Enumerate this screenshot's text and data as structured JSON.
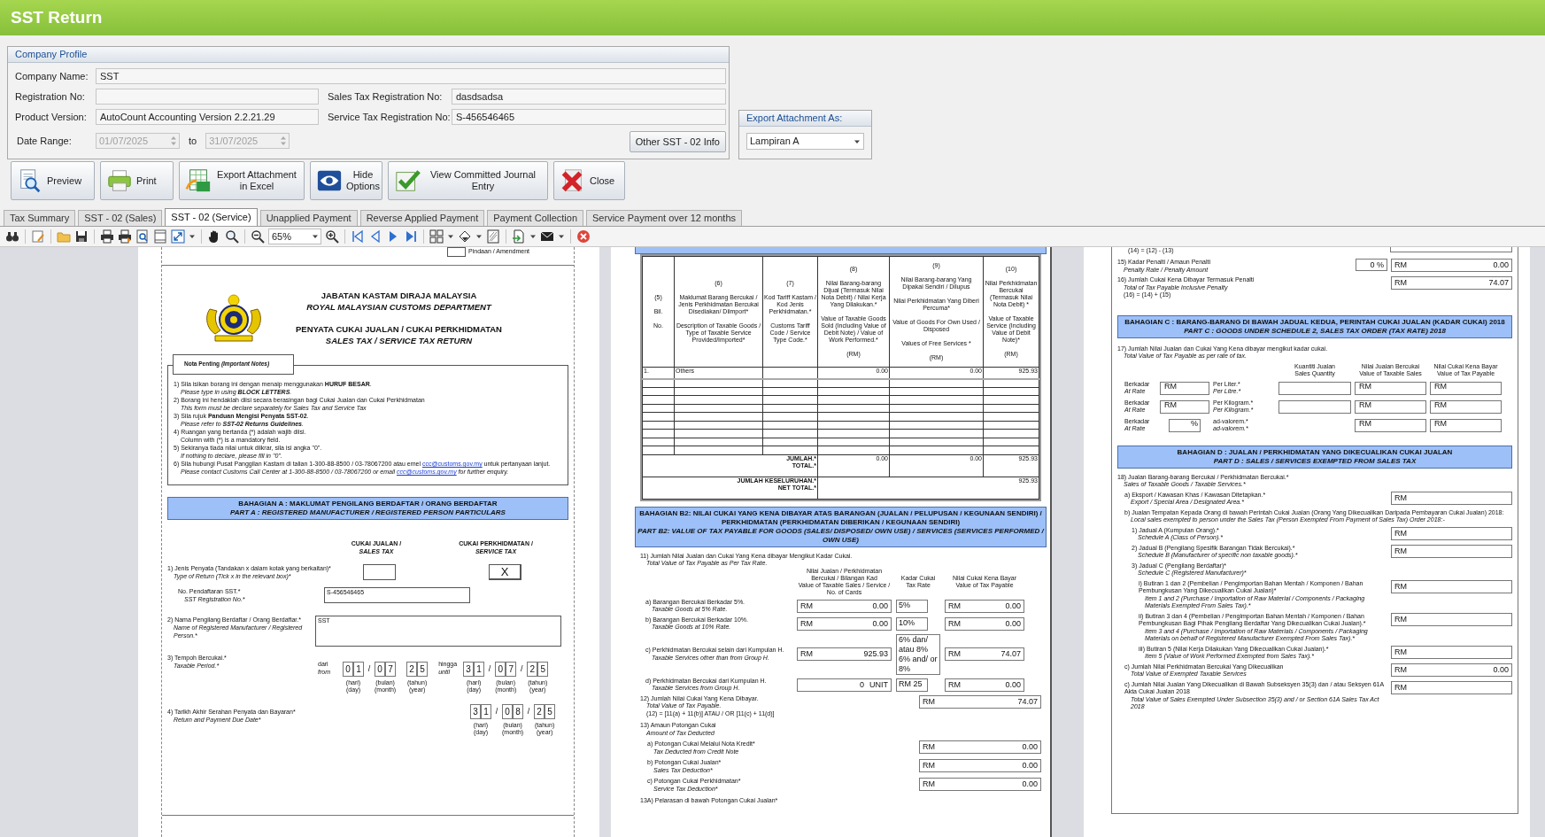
{
  "window": {
    "title": "SST Return"
  },
  "company_profile": {
    "title": "Company Profile",
    "company_name": {
      "label": "Company Name:",
      "value": "SST"
    },
    "registration_no": {
      "label": "Registration No:"
    },
    "sales_tax_registration_no": {
      "label": "Sales Tax Registration No:",
      "value": "dasdsadsa"
    },
    "product_version": {
      "label": "Product Version:",
      "value": "AutoCount Accounting Version 2.2.21.29"
    },
    "service_tax_registration_no": {
      "label": "Service Tax Registration No:",
      "value": "S-456546465"
    },
    "date_range": {
      "label": "Date Range:",
      "from": "01/07/2025",
      "to_label": "to",
      "to": "31/07/2025",
      "disabled": true
    },
    "other_info_button": "Other SST - 02 Info"
  },
  "export_attachment": {
    "title": "Export Attachment As:",
    "value": "Lampiran A"
  },
  "buttons": [
    {
      "kind": "preview",
      "label": "Preview"
    },
    {
      "kind": "print",
      "label": "Print"
    },
    {
      "kind": "excel",
      "label": "Export Attachment in Excel"
    },
    {
      "kind": "hide",
      "label": "Hide Options"
    },
    {
      "kind": "journal",
      "label": "View Committed Journal Entry"
    },
    {
      "kind": "close",
      "label": "Close"
    }
  ],
  "tabs": [
    {
      "label": "Tax Summary",
      "selected": false
    },
    {
      "label": "SST - 02 (Sales)",
      "selected": false
    },
    {
      "label": "SST - 02 (Service)",
      "selected": true
    },
    {
      "label": "Unapplied Payment",
      "selected": false
    },
    {
      "label": "Reverse Applied Payment",
      "selected": false
    },
    {
      "label": "Payment Collection",
      "selected": false
    },
    {
      "label": "Service Payment over 12 months",
      "selected": false
    }
  ],
  "toolbar": {
    "zoom": "65%"
  },
  "pages": [
    {
      "amendment": {
        "label": "Pindaan / Amendment",
        "checked": false
      },
      "header": {
        "agency": "JABATAN KASTAM DIRAJA MALAYSIA",
        "agency_english": "ROYAL MALAYSIAN CUSTOMS DEPARTMENT",
        "form": "PENYATA CUKAI JUALAN / CUKAI PERKHIDMATAN",
        "form_english": "SALES TAX / SERVICE TAX RETURN"
      },
      "notes": {
        "title": "Nota Penting *(Important Notes)*",
        "items": [
          {
            "malay": "1) Sila isikan borang ini dengan menaip menggunakan **HURUF BESAR**.",
            "english": "Please type in using **BLOCK LETTERS**."
          },
          {
            "malay": "2) Borang ini hendaklah diisi secara berasingan bagi Cukai Jualan dan Cukai Perkhidmatan",
            "english": "This form must be declare separately for Sales Tax and Service Tax"
          },
          {
            "malay": "3) Sila rujuk **Panduan Mengisi Penyata SST-02**.",
            "english": "Please refer to **SST-02 Returns Guidelines**."
          },
          {
            "malay": "4) Ruangan yang bertanda (*) adalah wajib diisi.",
            "english_plain": "Column with (*) is a mandatory field."
          },
          {
            "malay": "5) Sekiranya tiada nilai untuk diikrar, sila isi angka \"0\".",
            "english": "If nothing to declare, please fill in \"0\"."
          },
          {
            "malay": "6) Sila hubungi Pusat Panggilan Kastam di talian 1-300-88-8500 / 03-78067200 atau emel",
            "malay_link": "ccc@customs.gov.my",
            "malay_after": "untuk pertanyaan lanjut.",
            "english": "Please contact Customs Call Center at 1-300-88-8500 / 03-78067200 or email",
            "english_link": "ccc@customs.gov.my",
            "english_after": "for further enquiry."
          }
        ]
      },
      "band": {
        "malay": "BAHAGIAN A : MAKLUMAT PENGILANG BERDAFTAR / ORANG BERDAFTAR",
        "english": "PART A : REGISTERED MANUFACTURER / REGISTERED PERSON PARTICULARS"
      },
      "columns": [
        {
          "malay": "CUKAI JUALAN /",
          "english": "SALES TAX"
        },
        {
          "malay": "CUKAI PERKHIDMATAN /",
          "english": "SERVICE TAX"
        }
      ],
      "return_type": {
        "label": "1) Jenis Penyata (Tandakan x dalam kotak yang berkaitan)*",
        "english": "Type of Return (Tick x in the relevant box)*",
        "boxes": [
          {
            "checked": false
          },
          {
            "checked": true,
            "mark": "X"
          }
        ]
      },
      "registration": {
        "label": "No. Pendaftaran SST.*",
        "english": "SST Registration No.*",
        "value": "S-456546465"
      },
      "name": {
        "label": "2) Nama Pengilang Berdaftar / Orang Berdaftar.*",
        "english": "Name of Registered Manufacturer / Registered Person.*",
        "value": "SST"
      },
      "period": {
        "label": "3) Tempoh Bercukai.*",
        "english": "Taxable Period.*",
        "from": {
          "malay": "dari",
          "english": "from",
          "parts": [
            {
              "digits": [
                "0",
                "1"
              ],
              "malay": "(hari)",
              "english": "(day)"
            },
            {
              "digits": [
                "0",
                "7"
              ],
              "malay": "(bulan)",
              "english": "(month)"
            },
            {
              "digits": [
                "2",
                "5"
              ],
              "malay": "(tahun)",
              "english": "(year)"
            }
          ],
          "separators": [
            "/"
          ]
        },
        "until": {
          "malay": "hingga",
          "english": "until",
          "parts": [
            {
              "digits": [
                "3",
                "1"
              ],
              "malay": "(hari)",
              "english": "(day)"
            },
            {
              "digits": [
                "0",
                "7"
              ],
              "malay": "(bulan)",
              "english": "(month)"
            },
            {
              "digits": [
                "2",
                "5"
              ],
              "malay": "(tahun)",
              "english": "(year)"
            }
          ],
          "separators": [
            "/",
            "/"
          ]
        }
      },
      "due": {
        "label": "4) Tarikh Akhir Serahan Penyata dan Bayaran*",
        "english": "Return and Payment Due Date*",
        "date": {
          "parts": [
            {
              "digits": [
                "3",
                "1"
              ],
              "malay": "(hari)",
              "english": "(day)"
            },
            {
              "digits": [
                "0",
                "8"
              ],
              "malay": "(bulan)",
              "english": "(month)"
            },
            {
              "digits": [
                "2",
                "5"
              ],
              "malay": "(tahun)",
              "english": "(year)"
            }
          ],
          "separators": [
            "/",
            "/"
          ]
        }
      }
    },
    {
      "table": {
        "columns": [
          {
            "lines": [
              "(5)",
              "Bil.",
              "No."
            ]
          },
          {
            "lines": [
              "(6)",
              "Maklumat Barang Bercukai / Jenis Perkhidmatan Bercukai Disediakan/ Diimport*",
              "Description of Taxable Goods / Type of Taxable Service Provided/Imported*"
            ]
          },
          {
            "lines": [
              "(7)",
              "Kod Tariff Kastam / Kod Jenis Perkhidmatan.*",
              "Customs Tariff Code / Service Type Code.*"
            ]
          },
          {
            "lines": [
              "(8)",
              "Nilai Barang-barang Dijual (Termasuk Nilai Nota Debit) / Nilai Kerja Yang Dilakukan.*",
              "Value of Taxable Goods Sold (Including Value of Debit Note) / Value of Work Performed.*",
              "(RM)"
            ]
          },
          {
            "lines": [
              "(9)",
              "Nilai Barang-barang Yang Dipakai Sendiri / Dilupus",
              "Nilai Perkhidmatan Yang Diberi Percuma*",
              "Value of Goods For Own Used / Disposed",
              "Values of Free Services *",
              "(RM)"
            ]
          },
          {
            "lines": [
              "(10)",
              "Nilai Perkhidmatan Bercukai (Termasuk Nilai Nota Debit) *",
              "Value of Taxable Service (Including Value of Debit Note)*",
              "(RM)"
            ]
          }
        ],
        "rows": [
          [
            "1.",
            "Others",
            "",
            "0.00",
            "0.00",
            "925.93"
          ]
        ],
        "total": {
          "labels": "JUMLAH.*\nTOTAL.*",
          "values": [
            "0.00",
            "0.00",
            "925.93"
          ]
        },
        "net_total": {
          "labels": "JUMLAH KESELURUHAN.*\nNET TOTAL.*",
          "value": "925.93"
        }
      },
      "band": {
        "malay": "BAHAGIAN B2: NILAI CUKAI YANG KENA DIBAYAR ATAS BARANGAN (JUALAN / PELUPUSAN / KEGUNAAN SENDIRI) / PERKHIDMATAN (PERKHIDMATAN DIBERIKAN / KEGUNAAN SENDIRI)",
        "english": "PART B2: VALUE OF TAX PAYABLE FOR GOODS (SALES/ DISPOSED/ OWN USE) / SERVICES (SERVICES PERFORMED / OWN USE)"
      },
      "rates": {
        "label": "11) Jumlah Nilai Jualan dan Cukai Yang Kena dibayar Mengikut Kadar Cukai.",
        "english": "Total Value of Tax Payable as Per Tax Rate.",
        "columns": [
          {
            "malay": "Nilai Jualan / Perkhidmatan Bercukai / Bilangan Kad",
            "english": "Value of Taxable Sales / Service / No. of Cards"
          },
          {
            "malay": "Kadar Cukai",
            "english": "Tax Rate"
          },
          {
            "malay": "Nilai Cukai Kena Bayar",
            "english": "Value of Tax Payable"
          }
        ],
        "rows": [
          {
            "label": "a) Barangan Bercukai Berkadar 5%.",
            "english": "Taxable Goods at 5% Rate.",
            "amount": {
              "prefix": "RM",
              "value": "0.00"
            },
            "rate": "5%",
            "tax": {
              "prefix": "RM",
              "value": "0.00"
            }
          },
          {
            "label": "b) Barangan Bercukai Berkadar 10%.",
            "english": "Taxable Goods at 10% Rate.",
            "amount": {
              "prefix": "RM",
              "value": "0.00"
            },
            "rate": "10%",
            "tax": {
              "prefix": "RM",
              "value": "0.00"
            }
          },
          {
            "label": "c) Perkhidmatan Bercukai selain dari Kumpulan H.",
            "english": "Taxable Services other than from Group H.",
            "amount": {
              "prefix": "RM",
              "value": "925.93"
            },
            "rate": "6% dan/ atau 8% 6% and/ or 8%",
            "tax": {
              "prefix": "RM",
              "value": "74.07"
            }
          },
          {
            "label": "d) Perkhidmatan Bercukai dari Kumpulan H.",
            "english": "Taxable Services from Group H.",
            "amount": {
              "value": "0",
              "suffix": "UNIT"
            },
            "rate": "RM 25",
            "tax": {
              "prefix": "RM",
              "value": "0.00"
            }
          }
        ]
      },
      "items": [
        {
          "label": "12) Jumlah Nilai Cukai Yang Kena Dibayar.",
          "english": "Total Value of Tax Payable.",
          "formula": "(12) = [11(a) + 11(b)] ATAU / OR [11(c) + 11(d)]",
          "amount": {
            "prefix": "RM",
            "value": "74.07"
          }
        },
        {
          "label": "13) Amaun Potongan Cukai",
          "english": "Amount of Tax Deducted",
          "children": [
            {
              "label": "a) Potongan Cukai Melalui Nota Kredit*",
              "english": "Tax Deducted from Credit Note",
              "amount": {
                "prefix": "RM",
                "value": "0.00"
              }
            },
            {
              "label": "b) Potongan Cukai Jualan*",
              "english": "Sales Tax Deduction*",
              "amount": {
                "prefix": "RM",
                "value": "0.00"
              }
            },
            {
              "label": "c) Potongan Cukai Perkhidmatan*",
              "english": "Service Tax Deduction*",
              "amount": {
                "prefix": "RM",
                "value": "0.00"
              }
            }
          ]
        },
        {
          "label": "13A) Pelarasan di bawah Potongan Cukai Jualan*"
        }
      ]
    },
    {
      "top_formula": "(14) = (12) - (13)",
      "items_before": [
        {
          "label": "15) Kadar Penalti / Amaun Penalti",
          "english": "Penalty Rate / Penalty Amount",
          "rate": "0 %",
          "amount": {
            "prefix": "RM",
            "value": "0.00"
          }
        },
        {
          "label": "16) Jumlah Cukai Kena Dibayar Termasuk Penalti",
          "english": "Total of Tax Payable Inclusive Penalty",
          "formula": "(16) = (14) + (15)",
          "amount": {
            "prefix": "RM",
            "value": "74.07"
          }
        }
      ],
      "band_c": {
        "malay": "BAHAGIAN C : BARANG-BARANG DI BAWAH JADUAL KEDUA, PERINTAH CUKAI JUALAN (KADAR CUKAI) 2018",
        "english": "PART C : GOODS UNDER SCHEDULE 2, SALES TAX ORDER (TAX RATE) 2018"
      },
      "schedule": {
        "label": "17) Jumlah Nilai Jualan dan Cukai Yang Kena dibayar mengikut kadar cukai.",
        "english": "Total Value of Tax Payable as per rate of tax.",
        "columns": [
          {
            "malay": "Kuantiti Jualan",
            "english": "Sales Quantity"
          },
          {
            "malay": "Nilai Jualan Bercukai",
            "english": "Value of Taxable Sales"
          },
          {
            "malay": "Nilai Cukai Kena Bayar",
            "english": "Value of Tax Payable"
          }
        ],
        "rows": [
          {
            "kind": "quantity",
            "malay": "Berkadar",
            "english": "At Rate",
            "rate": "RM",
            "unit": "Per Liter.*",
            "unit_english": "Per Litre.*",
            "value": "RM",
            "tax": "RM"
          },
          {
            "kind": "quantity",
            "malay": "Berkadar",
            "english": "At Rate",
            "rate": "RM",
            "unit": "Per Kilogram.*",
            "unit_english": "Per Kilogram.*",
            "value": "RM",
            "tax": "RM"
          },
          {
            "kind": "percent",
            "malay": "Berkadar",
            "english": "At Rate",
            "rate": "%",
            "unit": "ad-valorem.*",
            "unit_english": "ad-valorem.*",
            "value": "RM",
            "tax": "RM"
          }
        ]
      },
      "band_d": {
        "malay": "BAHAGIAN D : JUALAN / PERKHIDMATAN YANG DIKECUALIKAN CUKAI JUALAN",
        "english": "PART D : SALES / SERVICES EXEMPTED FROM SALES TAX"
      },
      "items": [
        {
          "label": "18) Jualan Barang-barang Bercukai / Perkhidmatan Bercukai.*",
          "english": "Sales of Taxable Goods / Taxable Services.*",
          "children": [
            {
              "label": "a) Eksport / Kawasan Khas / Kawasan Ditetapkan.*",
              "english": "Export / Special Area / Designated Area.*",
              "amount": {
                "prefix": "RM"
              }
            },
            {
              "label": "b) Jualan Tempatan Kepada Orang di bawah Perintah Cukai Jualan (Orang Yang Dikecualikan Daripada Pembayaran Cukai Jualan) 2018:",
              "english": "Local sales exempted to person under the Sales Tax (Person Exempted From Payment of Sales Tax) Order 2018:-",
              "children": [
                {
                  "label": "1) Jadual A (Kumpulan Orang).*",
                  "english": "Schedule A (Class of Person).*",
                  "amount": {
                    "prefix": "RM"
                  }
                },
                {
                  "label": "2) Jadual B (Pengilang Spesifik Barangan Tidak Bercukai).*",
                  "english": "Schedule B (Manufacturer of specific non taxable goods).*",
                  "amount": {
                    "prefix": "RM"
                  }
                },
                {
                  "label": "3) Jadual C (Pengilang Berdaftar)*",
                  "english": "Schedule C (Registered Manufacturer)*",
                  "children": [
                    {
                      "label": "i) Butiran 1 dan 2 (Pembelian / Pengimportan Bahan Mentah / Komponen / Bahan Pembungkusan Yang Dikecualikan Cukai Jualan)*",
                      "english": "Item 1 and 2 (Purchase / Importation of Raw Material / Components / Packaging Materials Exempted From Sales Tax).*",
                      "amount": {
                        "prefix": "RM"
                      }
                    },
                    {
                      "label": "ii) Butiran 3 dan 4 (Pembelian / Pengimportan Bahan Mentah / Komponen / Bahan Pembungkusan Bagi Pihak Pengilang Berdaftar Yang Dikecualikan Cukai Jualan).*",
                      "english": "Item 3 and 4 (Purchase / Importation of Raw Materials / Components / Packaging Materials on behalf of Registered Manufacturer Exempted From Sales Tax).*",
                      "amount": {
                        "prefix": "RM"
                      }
                    },
                    {
                      "label": "iii) Butiran 5 (Nilai Kerja Dilakukan Yang Dikecualikan Cukai Jualan).*",
                      "english": "Item 5 (Value of Work Performed Exempted from Sales Tax).*",
                      "amount": {
                        "prefix": "RM"
                      }
                    }
                  ]
                }
              ]
            },
            {
              "label": "c) Jumlah Nilai Perkhidmatan Bercukai Yang Dikecualikan",
              "english": "Total Value of Exempted Taxable Services",
              "amount": {
                "prefix": "RM",
                "value": "0.00"
              }
            },
            {
              "label": "c) Jumlah Nilai Jualan Yang Dikecualikan di Bawah Subseksyen 35(3) dan / atau Seksyen 61A Akta Cukai Jualan 2018",
              "english": "Total Value of Sales Exempted Under Subsection 35(3) and / or Section 61A Sales Tax Act 2018",
              "amount": {
                "prefix": "RM"
              }
            }
          ]
        }
      ]
    }
  ]
}
